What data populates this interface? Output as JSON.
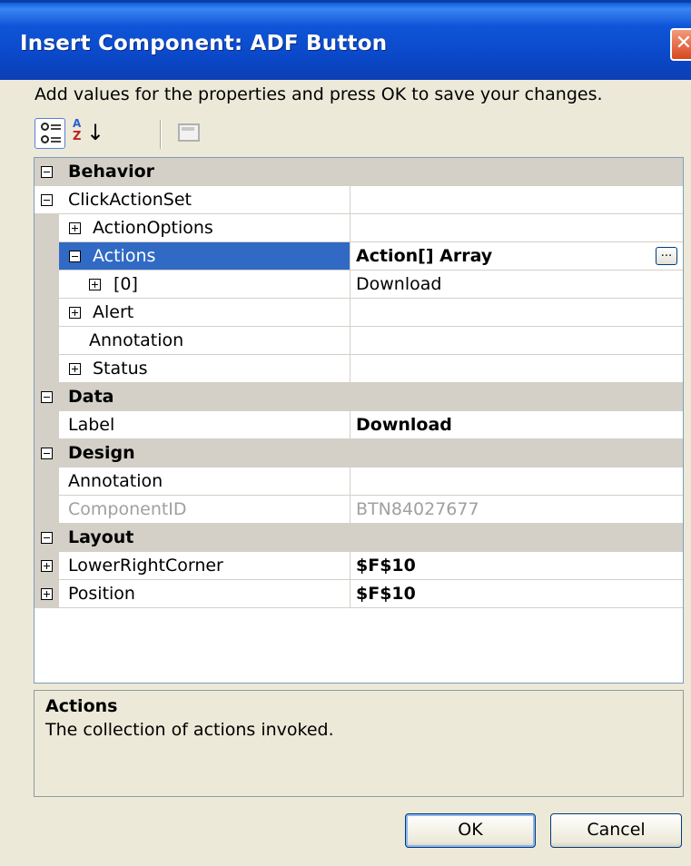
{
  "window": {
    "title": "Insert Component: ADF Button",
    "close_glyph": "✕"
  },
  "instruction": "Add values for the properties and press OK to save your changes.",
  "toolbar": {
    "categorized_icon": "categorized-icon",
    "alphabetical_icon": "alphabetical-sort-icon",
    "alpha_a": "A",
    "alpha_z": "Z",
    "alpha_arrow": "↓",
    "property_pages_icon": "property-pages-icon"
  },
  "properties": {
    "behavior": "Behavior",
    "click_action_set": "ClickActionSet",
    "action_options": "ActionOptions",
    "actions": {
      "name": "Actions",
      "value": "Action[] Array",
      "button": "..."
    },
    "item0": {
      "name": "[0]",
      "value": "Download"
    },
    "alert": "Alert",
    "annotation_behavior": "Annotation",
    "status": "Status",
    "data": "Data",
    "label": {
      "name": "Label",
      "value": "Download"
    },
    "design": "Design",
    "annotation_design": "Annotation",
    "component_id": {
      "name": "ComponentID",
      "value": "BTN84027677"
    },
    "layout": "Layout",
    "lower_right_corner": {
      "name": "LowerRightCorner",
      "value": "$F$10"
    },
    "position": {
      "name": "Position",
      "value": "$F$10"
    }
  },
  "help": {
    "title": "Actions",
    "description": "The collection of actions invoked."
  },
  "buttons": {
    "ok": "OK",
    "cancel": "Cancel"
  },
  "colors": {
    "selection": "#316ac5",
    "titlebar": "#0a48c8",
    "category": "#d4d0c8"
  }
}
